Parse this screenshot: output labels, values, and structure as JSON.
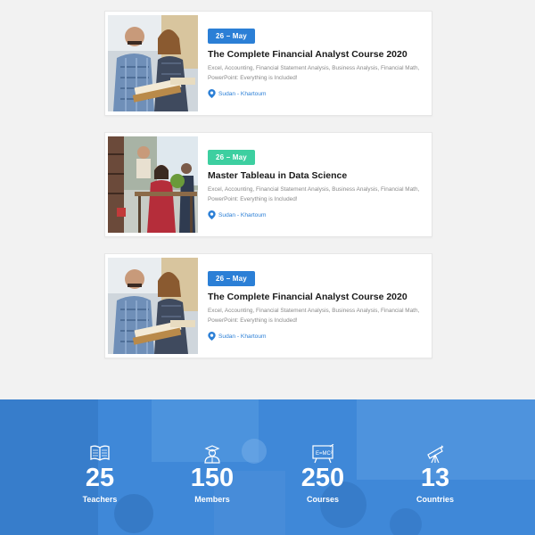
{
  "events": [
    {
      "date": "26 – May",
      "badge_color": "#2b7fd6",
      "title": "The Complete Financial Analyst Course 2020",
      "description": "Excel, Accounting, Financial Statement Analysis, Business Analysis, Financial Math, PowerPoint: Everything is Included!",
      "location": "Sudan - Khartoum",
      "image": "students-reading-photo"
    },
    {
      "date": "26 – May",
      "badge_color": "#3dcfa0",
      "title": "Master Tableau in Data Science",
      "description": "Excel, Accounting, Financial Statement Analysis, Business Analysis, Financial Math, PowerPoint: Everything is Included!",
      "location": "Sudan - Khartoum",
      "image": "library-study-photo"
    },
    {
      "date": "26 – May",
      "badge_color": "#2b7fd6",
      "title": "The Complete Financial Analyst Course 2020",
      "description": "Excel, Accounting, Financial Statement Analysis, Business Analysis, Financial Math, PowerPoint: Everything is Included!",
      "location": "Sudan - Khartoum",
      "image": "students-reading-photo"
    }
  ],
  "stats": [
    {
      "icon": "book-icon",
      "number": "25",
      "label": "Teachers"
    },
    {
      "icon": "graduate-icon",
      "number": "150",
      "label": "Members"
    },
    {
      "icon": "formula-board-icon",
      "number": "250",
      "label": "Courses"
    },
    {
      "icon": "telescope-icon",
      "number": "13",
      "label": "Countries"
    }
  ],
  "colors": {
    "accent": "#2b7fd6",
    "badge_alt": "#3dcfa0",
    "stats_bg": "#4a90dc"
  }
}
